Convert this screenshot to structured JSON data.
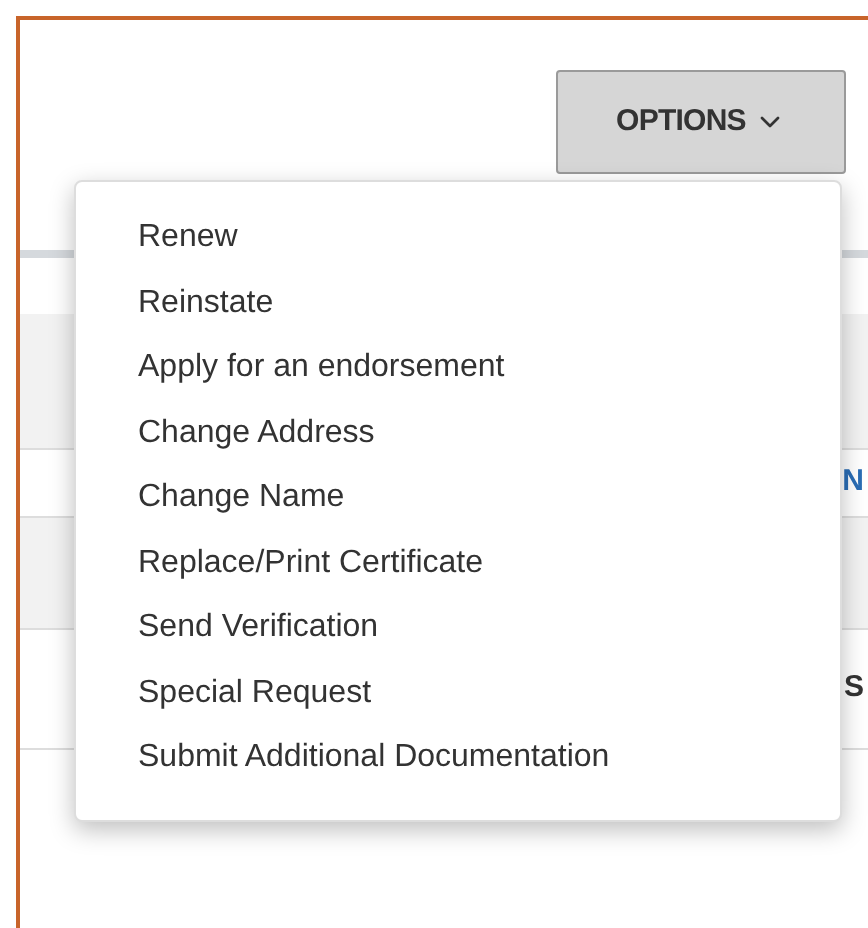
{
  "options_button": {
    "label": "OPTIONS"
  },
  "background_texts": [
    "N",
    "S"
  ],
  "menu": {
    "items": [
      {
        "label": "Renew"
      },
      {
        "label": "Reinstate"
      },
      {
        "label": "Apply for an endorsement"
      },
      {
        "label": "Change Address"
      },
      {
        "label": "Change Name"
      },
      {
        "label": "Replace/Print Certificate"
      },
      {
        "label": "Send Verification"
      },
      {
        "label": "Special Request"
      },
      {
        "label": "Submit Additional Documentation"
      }
    ]
  }
}
